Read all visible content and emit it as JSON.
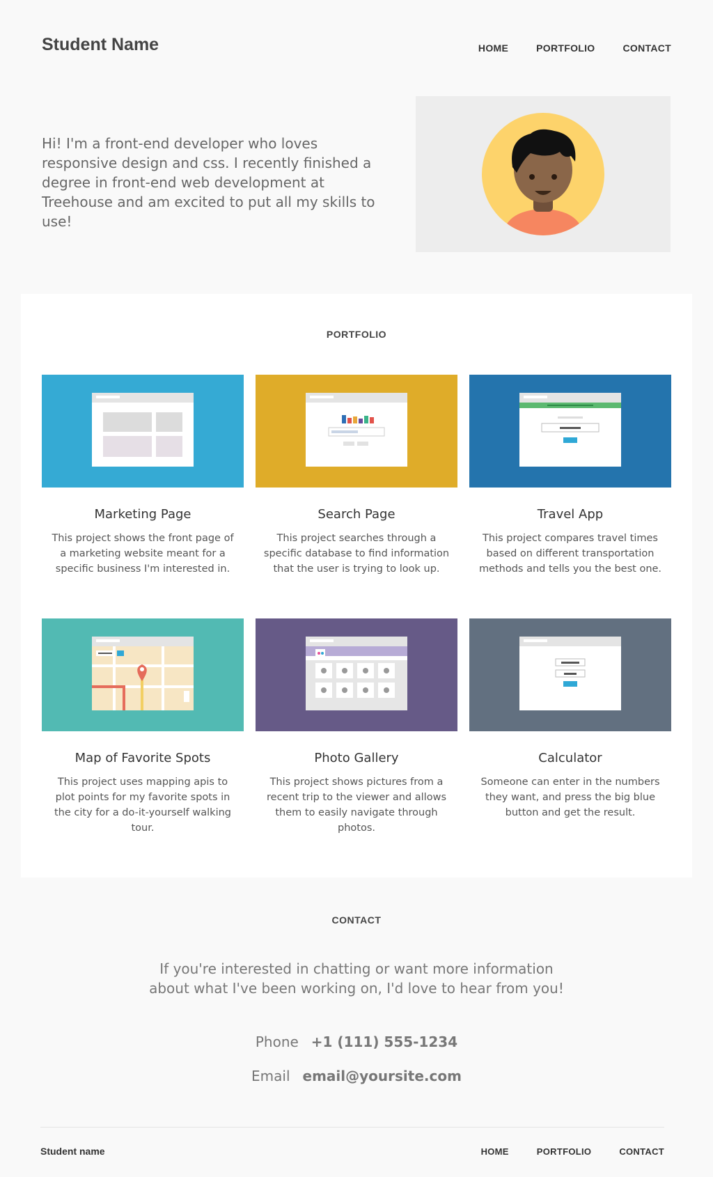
{
  "header": {
    "brand": "Student Name",
    "nav": [
      "HOME",
      "PORTFOLIO",
      "CONTACT"
    ]
  },
  "intro": {
    "text": "Hi! I'm a front-end developer who loves responsive design and css. I recently finished a degree in front-end web development at Treehouse and am excited to put all my skills to use!"
  },
  "portfolio": {
    "title": "PORTFOLIO",
    "projects": [
      {
        "title": "Marketing Page",
        "description": "This project shows the front page of a marketing website meant for a specific business I'm interested in.",
        "color": "#35aad4"
      },
      {
        "title": "Search Page",
        "description": "This project searches through a specific database to find information that the user is trying to look up.",
        "color": "#dfac29"
      },
      {
        "title": "Travel App",
        "description": "This project compares travel times based on different transportation methods and tells you the best one.",
        "color": "#2474ad"
      },
      {
        "title": "Map of Favorite Spots",
        "description": "This project uses mapping apis to plot points for my favorite spots in the city for a do-it-yourself walking tour.",
        "color": "#52bab3"
      },
      {
        "title": "Photo Gallery",
        "description": "This project shows pictures from a recent trip to the viewer and allows them to easily navigate through photos.",
        "color": "#665a87"
      },
      {
        "title": "Calculator",
        "description": "Someone can enter in the numbers they want, and press the big blue button and get the result.",
        "color": "#627080"
      }
    ]
  },
  "contact": {
    "title": "CONTACT",
    "lead_line1": "If you're interested in chatting or want more information",
    "lead_line2": "about what I've been working on, I'd love to hear from you!",
    "phone_label": "Phone",
    "phone_value": "+1 (111) 555-1234",
    "email_label": "Email",
    "email_value": "email@yoursite.com"
  },
  "footer": {
    "brand": "Student name",
    "nav": [
      "HOME",
      "PORTFOLIO",
      "CONTACT"
    ]
  }
}
